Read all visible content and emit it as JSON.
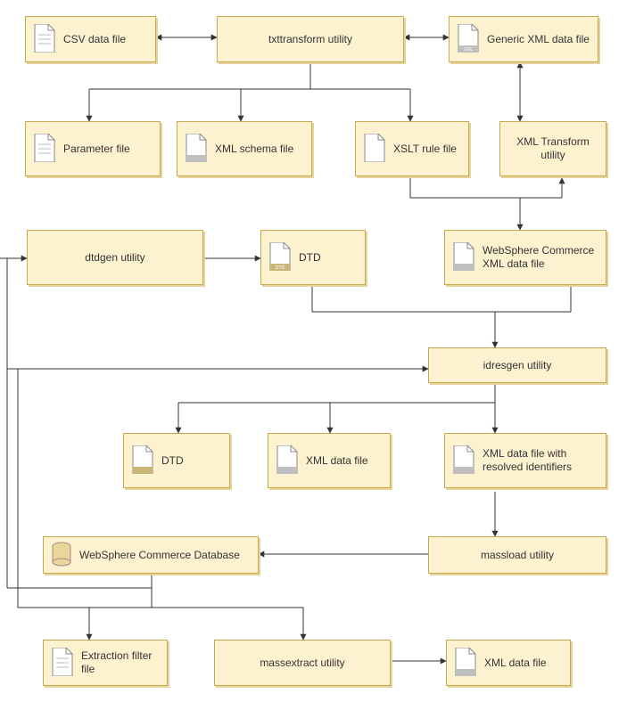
{
  "nodes": {
    "csv": "CSV data file",
    "txttransform": "txttransform utility",
    "genericxml": "Generic XML data file",
    "paramfile": "Parameter file",
    "xmlschema": "XML schema file",
    "xsltrule": "XSLT rule file",
    "xmltransform": "XML Transform utility",
    "dtdgen": "dtdgen utility",
    "dtd1": "DTD",
    "wsxml": "WebSphere Commerce XML data file",
    "idresgen": "idresgen utility",
    "dtd2": "DTD",
    "xmlfile2": "XML data file",
    "resolved": "XML data file with resolved identifiers",
    "wcdb": "WebSphere Commerce Database",
    "massload": "massload utility",
    "extraction": "Extraction filter file",
    "massextract": "massextract utility",
    "xmlfile3": "XML data file"
  },
  "icon_labels": {
    "dtd": "DTD",
    "xml": "XML"
  }
}
